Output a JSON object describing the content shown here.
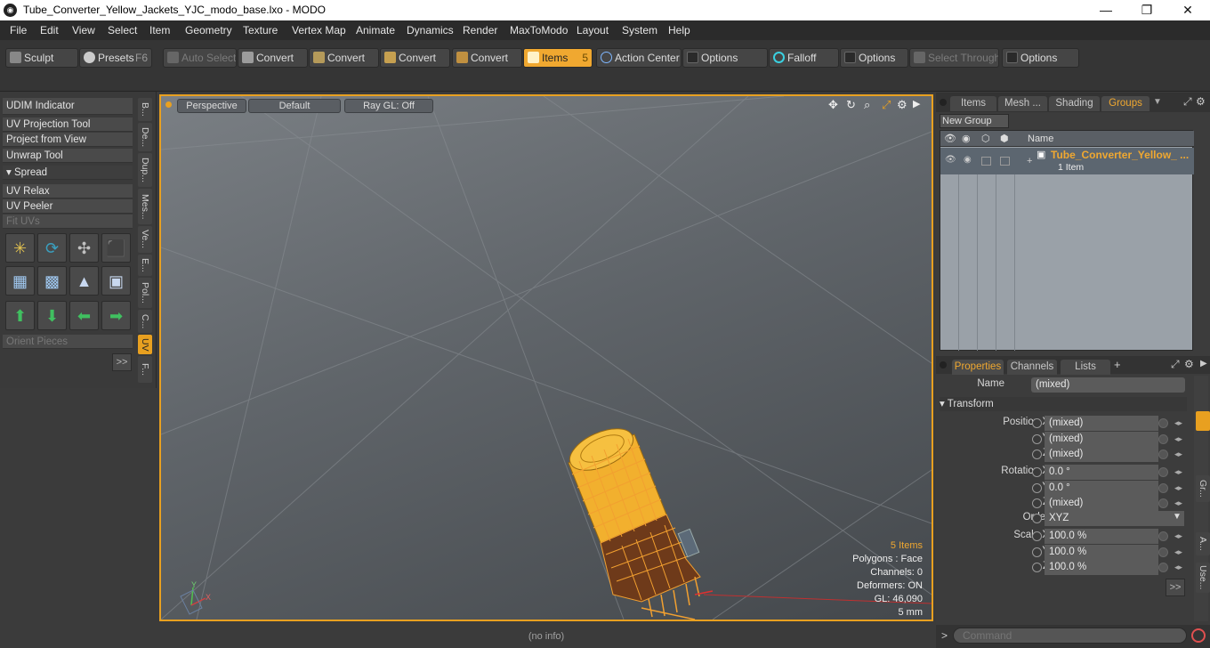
{
  "window": {
    "title": "Tube_Converter_Yellow_Jackets_YJC_modo_base.lxo - MODO",
    "logo": "modo-logo-icon",
    "minimize": "—",
    "maximize": "❐",
    "close": "✕"
  },
  "menu": [
    "File",
    "Edit",
    "View",
    "Select",
    "Item",
    "Geometry",
    "Texture",
    "Vertex Map",
    "Animate",
    "Dynamics",
    "Render",
    "MaxToModo",
    "Layout",
    "System",
    "Help"
  ],
  "toolbar": {
    "sculpt": "Sculpt",
    "presets": "Presets",
    "presets_key": "F6",
    "auto_select": "Auto Select",
    "convert1": "Convert",
    "convert2": "Convert",
    "convert3": "Convert",
    "convert4": "Convert",
    "items": "Items",
    "items_key": "5",
    "action_center": "Action Center",
    "options1": "Options",
    "falloff": "Falloff",
    "options2": "Options",
    "select_through": "Select Through",
    "options3": "Options"
  },
  "left_tools": {
    "udim": "UDIM Indicator",
    "projection": "UV Projection Tool",
    "project_view": "Project from View",
    "unwrap": "Unwrap Tool",
    "spread": "Spread",
    "relax": "UV Relax",
    "peeler": "UV Peeler",
    "fit": "Fit UVs",
    "orient": "Orient Pieces",
    "more": ">>"
  },
  "side_tabs": [
    "B...",
    "De...",
    "Dup...",
    "Mes...",
    "Ve...",
    "E...",
    "Pol...",
    "C...",
    "UV",
    "F..."
  ],
  "viewport": {
    "perspective": "Perspective",
    "default": "Default",
    "raygl": "Ray GL: Off",
    "info": {
      "items": "5 Items",
      "polygons": "Polygons : Face",
      "channels": "Channels: 0",
      "deformers": "Deformers: ON",
      "gl": "GL: 46,090",
      "unit": "5 mm"
    },
    "axis_y": "Y",
    "axis_x": "X"
  },
  "status": "(no info)",
  "groups_panel": {
    "tabs": [
      "Items",
      "Mesh ...",
      "Shading",
      "Groups"
    ],
    "new_group": "New Group",
    "col_name": "Name",
    "group_name": "Tube_Converter_Yellow_ ...",
    "group_count": "1 Item"
  },
  "properties_panel": {
    "tabs": [
      "Properties",
      "Channels",
      "Lists"
    ],
    "add": "+",
    "name_label": "Name",
    "name_value": "(mixed)",
    "transform": "Transform",
    "rows": [
      {
        "label": "Position X",
        "value": "(mixed)"
      },
      {
        "label": "Y",
        "value": "(mixed)"
      },
      {
        "label": "Z",
        "value": "(mixed)"
      },
      {
        "label": "Rotation X",
        "value": "0.0 °"
      },
      {
        "label": "Y",
        "value": "0.0 °"
      },
      {
        "label": "Z",
        "value": "(mixed)"
      },
      {
        "label": "Order",
        "value": "XYZ"
      },
      {
        "label": "Scale X",
        "value": "100.0 %"
      },
      {
        "label": "Y",
        "value": "100.0 %"
      },
      {
        "label": "Z",
        "value": "100.0 %"
      }
    ],
    "more": ">>",
    "side_labels": [
      "Gr...",
      "A...",
      "Use..."
    ]
  },
  "command": {
    "placeholder": "Command",
    "prompt": ">"
  },
  "colors": {
    "accent": "#f0a830",
    "object": "#f2b02e",
    "viewport_border": "#e8a020"
  }
}
